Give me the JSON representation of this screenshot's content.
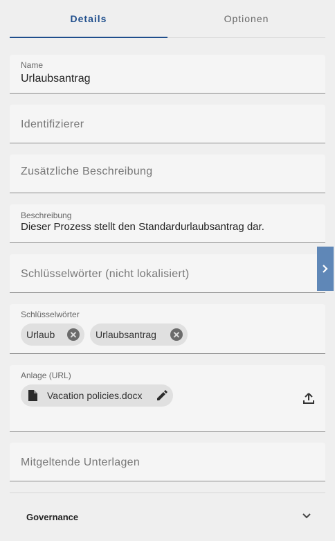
{
  "tabs": [
    {
      "label": "Details",
      "active": true
    },
    {
      "label": "Optionen",
      "active": false
    }
  ],
  "fields": {
    "name": {
      "label": "Name",
      "value": "Urlaubsantrag"
    },
    "identifier": {
      "placeholder": "Identifizierer"
    },
    "additional_description": {
      "placeholder": "Zusätzliche Beschreibung"
    },
    "description": {
      "label": "Beschreibung",
      "value": "Dieser Prozess stellt den Standardurlaubsantrag dar."
    },
    "keywords_unlocalized": {
      "placeholder": "Schlüsselwörter (nicht lokalisiert)"
    },
    "keywords": {
      "label": "Schlüsselwörter",
      "chips": [
        "Urlaub",
        "Urlaubsantrag"
      ]
    },
    "attachment": {
      "label": "Anlage (URL)",
      "file": "Vacation policies.docx"
    },
    "related_documents": {
      "placeholder": "Mitgeltende Unterlagen"
    }
  },
  "governance": {
    "title": "Governance",
    "expanded": false
  },
  "colors": {
    "accent": "#1f4e8c",
    "side_toggle": "#5f87b7",
    "background": "#efefef",
    "field_bg": "#f5f5f5"
  },
  "icons": {
    "side_toggle": "chevron-right-icon",
    "chip_remove": "cancel-circle-icon",
    "file": "file-icon",
    "edit": "pencil-icon",
    "upload": "upload-icon",
    "expand": "chevron-down-icon"
  }
}
